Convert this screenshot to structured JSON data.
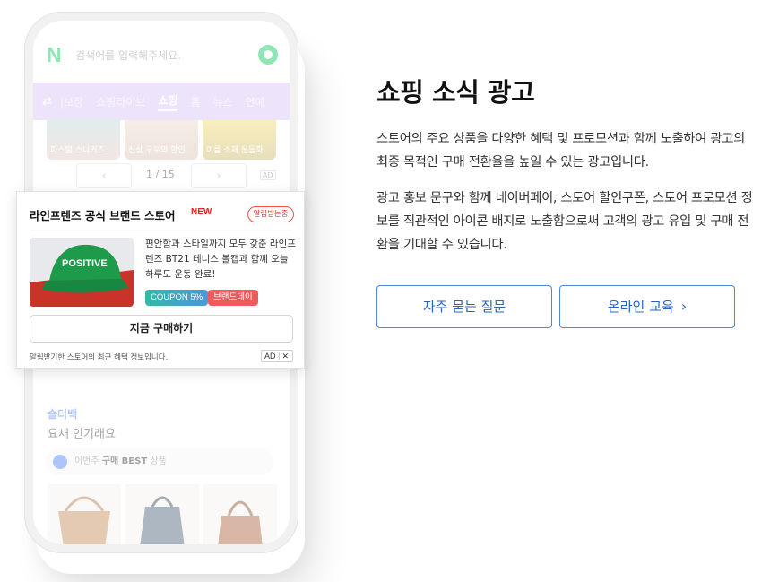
{
  "phone": {
    "search": {
      "logo": "N",
      "placeholder": "검색어를 입력해주세요."
    },
    "nav": {
      "swap_icon": "⇄",
      "tabs": [
        {
          "label": "|보장",
          "active": false
        },
        {
          "label": "쇼핑라이브",
          "active": false
        },
        {
          "label": "쇼핑",
          "active": true
        },
        {
          "label": "홈",
          "active": false
        },
        {
          "label": "뉴스",
          "active": false
        },
        {
          "label": "연예",
          "active": false
        }
      ]
    },
    "product_captions": [
      "파스텔 스니커즈",
      "신상 구두의 할인",
      "여름 소재 운동화"
    ],
    "pager": {
      "prev": "‹",
      "count": "1 / 15",
      "next": "›",
      "ad": "AD"
    },
    "shoulder": {
      "title": "숄더백",
      "subtitle": "요새 인기래요"
    },
    "best_pill": {
      "prefix": "이번주",
      "bold": "구매 BEST",
      "suffix": "상품"
    },
    "ad_card": {
      "store_name": "라인프렌즈 공식 브랜드 스토어",
      "new_badge": "NEW",
      "alert_label": "알림받는중",
      "image_cap_text": "POSITIVE",
      "description": "편안함과 스타일까지 모두 갖춘 라인프렌즈 BT21 테니스 볼캡과 함께 오늘 하루도 운동 완료!",
      "coupon_tag": "COUPON 5%",
      "brand_tag": "브랜드데이",
      "buy_label": "지금 구매하기",
      "footer": "알림받기한 스토어의 최근 혜택 정보입니다.",
      "ad_label": "AD",
      "close": "✕"
    }
  },
  "content": {
    "title": "쇼핑 소식 광고",
    "paragraph1": "스토어의 주요 상품을 다양한 혜택 및 프로모션과 함께 노출하여 광고의 최종 목적인 구매 전환율을 높일 수 있는 광고입니다.",
    "paragraph2": "광고 홍보 문구와 함께 네이버페이, 스토어 할인쿠폰, 스토어 프로모션 정보를 직관적인 아이콘 배지로 노출함으로써 고객의 광고 유입 및 구매 전환을 기대할 수 있습니다.",
    "faq_button": "자주 묻는 질문",
    "edu_button": "온라인 교육",
    "edu_chevron": "›"
  },
  "colors": {
    "naver_green": "#03c75a",
    "nav_purple": "#d7c4f7",
    "link_blue": "#2a63c5",
    "new_red": "#e8231e"
  }
}
